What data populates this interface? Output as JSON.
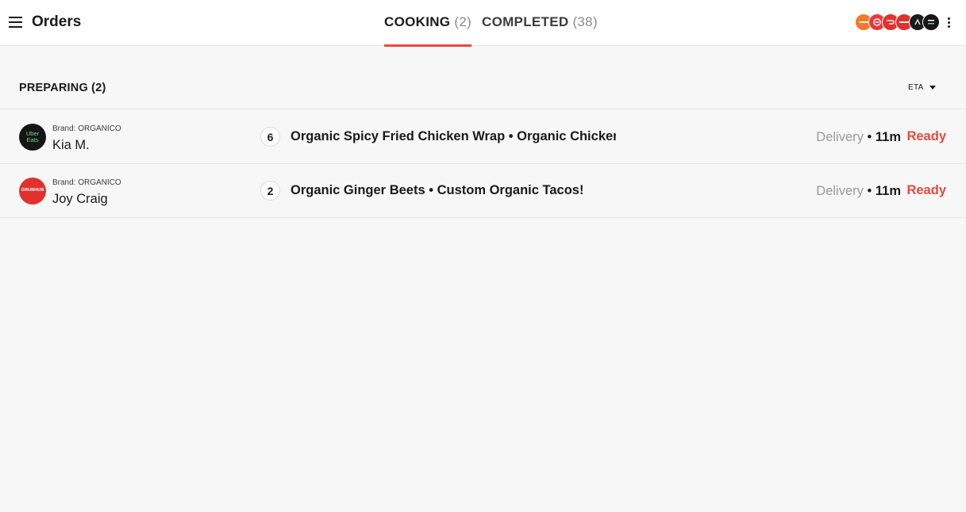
{
  "header": {
    "title": "Orders",
    "tabs": [
      {
        "label": "COOKING",
        "count": "(2)",
        "active": true
      },
      {
        "label": "COMPLETED",
        "count": "(38)",
        "active": false
      }
    ],
    "providers": [
      {
        "icon": "orange-provider-icon",
        "color": "#f47a2a"
      },
      {
        "icon": "red-provider-icon",
        "color": "#e9383b"
      },
      {
        "icon": "doordash-icon",
        "color": "#e82f2f"
      },
      {
        "icon": "grubhub-icon",
        "color": "#e0312f"
      },
      {
        "icon": "postmates-icon",
        "color": "#1c1c1c"
      },
      {
        "icon": "uber-eats-icon",
        "color": "#161616"
      }
    ]
  },
  "section": {
    "title": "PREPARING (2)",
    "sort_label": "ETA"
  },
  "orders": [
    {
      "avatar_text": "Uber Eats",
      "avatar_icon": "uber-eats-logo",
      "brand": "Brand: ORGANICO",
      "customer": "Kia M.",
      "quantity": "6",
      "items": "Organic Spicy Fried Chicken Wrap • Organic Chicken Faji...",
      "mode": "Delivery",
      "separator": "•",
      "eta": "11m",
      "action": "Ready"
    },
    {
      "avatar_text": "GRUBHUB",
      "avatar_icon": "grubhub-logo",
      "brand": "Brand: ORGANICO",
      "customer": "Joy Craig",
      "quantity": "2",
      "items": "Organic Ginger Beets • Custom Organic Tacos!",
      "mode": "Delivery",
      "separator": "•",
      "eta": "11m",
      "action": "Ready"
    }
  ],
  "colors": {
    "accent": "#e8493f",
    "background": "#f7f7f7"
  }
}
